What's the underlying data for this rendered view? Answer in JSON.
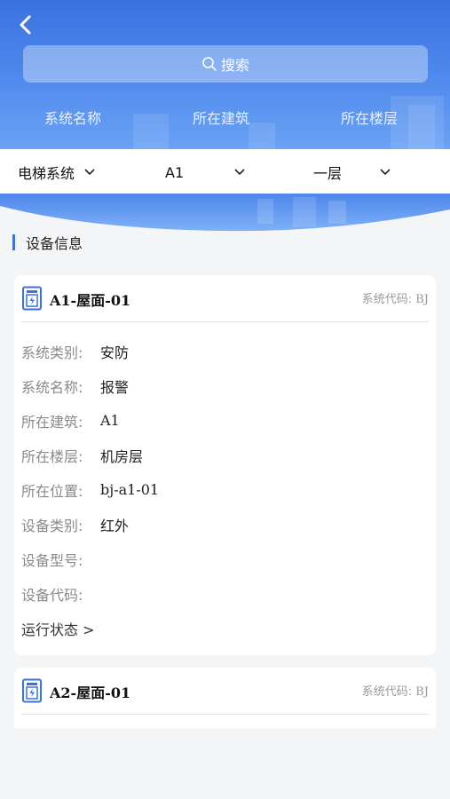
{
  "nav": {
    "back_icon": "chevron-left-icon"
  },
  "search": {
    "placeholder": "搜索",
    "icon": "search-icon"
  },
  "column_headers": [
    "系统名称",
    "所在建筑",
    "所在楼层"
  ],
  "filters": [
    {
      "value": "电梯系统",
      "icon": "chevron-down-icon"
    },
    {
      "value": "A1",
      "icon": "chevron-down-icon"
    },
    {
      "value": "一层",
      "icon": "chevron-down-icon"
    }
  ],
  "section": {
    "title": "设备信息"
  },
  "cards": [
    {
      "name": "A1-屋面-01",
      "code_label": "系统代码:",
      "code_value": "BJ",
      "rows": [
        {
          "key": "系统类别:",
          "value": "安防"
        },
        {
          "key": "系统名称:",
          "value": "报警"
        },
        {
          "key": "所在建筑:",
          "value": "A1"
        },
        {
          "key": "所在楼层:",
          "value": "机房层"
        },
        {
          "key": "所在位置:",
          "value": "bj-a1-01"
        },
        {
          "key": "设备类别:",
          "value": "红外"
        },
        {
          "key": "设备型号:",
          "value": ""
        },
        {
          "key": "设备代码:",
          "value": ""
        }
      ],
      "run_state": "运行状态 >"
    },
    {
      "name": "A2-屋面-01",
      "code_label": "系统代码:",
      "code_value": "BJ"
    }
  ],
  "colors": {
    "primary": "#3a72e0",
    "header_light": "#6aa2f5",
    "background": "#f4f5f7"
  }
}
